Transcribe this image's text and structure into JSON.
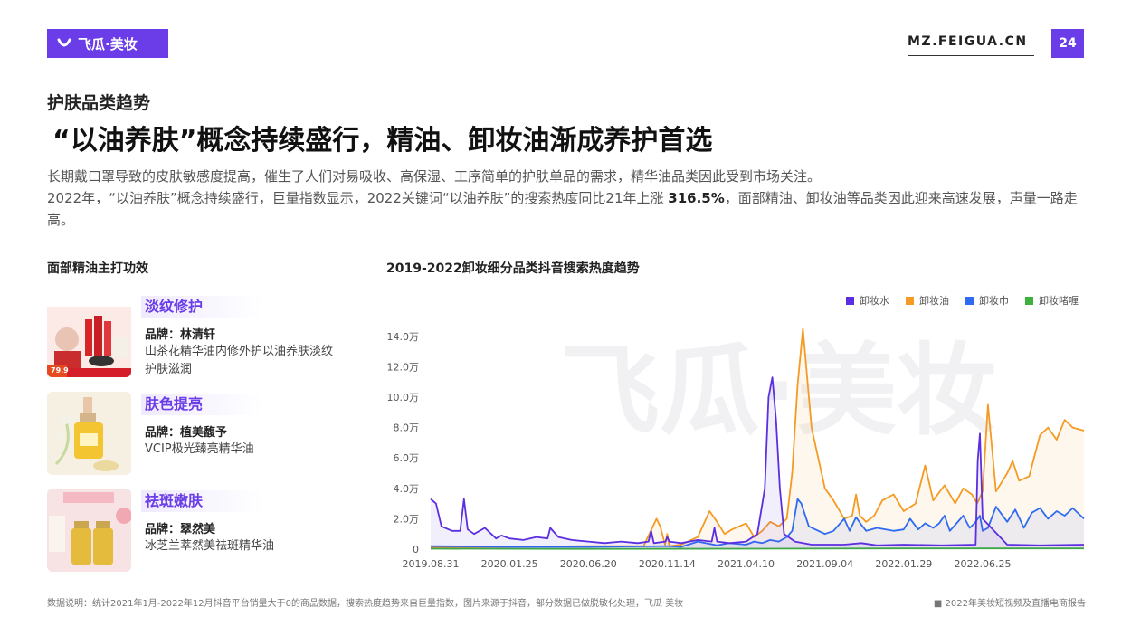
{
  "header": {
    "brand_label": "飞瓜·美妆",
    "site": "MZ.FEIGUA.CN",
    "page_number": "24",
    "accent_color": "#6a3de8"
  },
  "section_title": "护肤品类趋势",
  "headline": "“以油养肤”概念持续盛行，精油、卸妆油渐成养护首选",
  "intro": {
    "line1": "长期戴口罩导致的皮肤敏感度提高，催生了人们对易吸收、高保湿、工序简单的护肤单品的需求，精华油品类因此受到市场关注。",
    "line2_a": "2022年，“以油养肤”概念持续盛行，巨量指数显示，2022关键词“以油养肤”的搜索热度同比21年上涨 ",
    "line2_highlight": "316.5%",
    "line2_b": "，面部精油、卸妆油等品类因此迎来高速发展，声量一路走高。"
  },
  "left_panel": {
    "title": "面部精油主打功效",
    "cards": [
      {
        "effect": "淡纹修护",
        "brand": "品牌：林清轩",
        "product": "山茶花精华油内修外护以油养肤淡纹护肤滋润",
        "icon": "product-photo-red-bottles-icon",
        "thumb_text": "79.9"
      },
      {
        "effect": "肤色提亮",
        "brand": "品牌：植美馥予",
        "product": "VCIP极光臻亮精华油",
        "icon": "product-photo-dropper-bottle-icon"
      },
      {
        "effect": "祛斑嫩肤",
        "brand": "品牌：翠然美",
        "product": "冰芝兰萃然美祛斑精华油",
        "icon": "product-photo-gold-bottles-icon"
      }
    ]
  },
  "chart_data": {
    "type": "line",
    "title": "2019-2022卸妆细分品类抖音搜索热度趋势",
    "x_tick_labels": [
      "2019.08.31",
      "2020.01.25",
      "2020.06.20",
      "2020.11.14",
      "2021.04.10",
      "2021.09.04",
      "2022.01.29",
      "2022.06.25"
    ],
    "y_tick_labels": [
      "0",
      "2.0万",
      "4.0万",
      "6.0万",
      "8.0万",
      "10.0万",
      "12.0万",
      "14.0万"
    ],
    "ylim": [
      0,
      150000
    ],
    "x_range": [
      "2019.08.31",
      "2022.12.31"
    ],
    "grid": false,
    "legend_position": "top-right",
    "watermark": "飞瓜·美妆",
    "series": [
      {
        "name": "卸妆水",
        "color": "#5b2ee0",
        "x": [
          "2019.08.31",
          "2019.09.10",
          "2019.09.20",
          "2019.10.10",
          "2019.10.25",
          "2019.11.01",
          "2019.11.08",
          "2019.11.20",
          "2019.12.10",
          "2019.12.31",
          "2020.01.10",
          "2020.01.25",
          "2020.02.20",
          "2020.03.15",
          "2020.04.05",
          "2020.04.10",
          "2020.04.25",
          "2020.05.20",
          "2020.06.20",
          "2020.07.20",
          "2020.08.20",
          "2020.09.20",
          "2020.10.10",
          "2020.10.15",
          "2020.10.20",
          "2020.11.11",
          "2020.11.14",
          "2020.11.18",
          "2020.12.10",
          "2021.01.10",
          "2021.02.05",
          "2021.02.10",
          "2021.02.15",
          "2021.03.10",
          "2021.04.10",
          "2021.05.01",
          "2021.05.15",
          "2021.05.22",
          "2021.05.29",
          "2021.06.05",
          "2021.06.12",
          "2021.06.20",
          "2021.07.10",
          "2021.07.25",
          "2021.08.10",
          "2021.09.04",
          "2021.10.10",
          "2021.11.11",
          "2021.12.10",
          "2022.01.29",
          "2022.04.10",
          "2022.06.12",
          "2022.06.16",
          "2022.06.20",
          "2022.06.25",
          "2022.08.10",
          "2022.10.10",
          "2022.12.31"
        ],
        "values": [
          33000,
          30000,
          15000,
          12000,
          12000,
          33000,
          13000,
          10000,
          14000,
          7000,
          9000,
          7000,
          6000,
          8000,
          7000,
          14000,
          8000,
          6000,
          5000,
          4000,
          5000,
          4000,
          5000,
          12000,
          4000,
          5000,
          8000,
          5000,
          4000,
          6000,
          5000,
          14000,
          5000,
          4000,
          5000,
          10000,
          40000,
          100000,
          113000,
          85000,
          40000,
          10000,
          5000,
          4000,
          3000,
          3000,
          3000,
          4000,
          2500,
          3000,
          2500,
          3000,
          58000,
          76000,
          20000,
          3000,
          2500,
          3000
        ]
      },
      {
        "name": "卸妆油",
        "color": "#f59a23",
        "x": [
          "2019.08.31",
          "2020.06.20",
          "2020.10.01",
          "2020.10.25",
          "2020.11.01",
          "2020.11.10",
          "2020.11.14",
          "2020.11.18",
          "2020.12.10",
          "2021.01.10",
          "2021.02.01",
          "2021.02.15",
          "2021.03.01",
          "2021.03.15",
          "2021.04.10",
          "2021.04.25",
          "2021.05.10",
          "2021.05.25",
          "2021.06.10",
          "2021.06.25",
          "2021.07.05",
          "2021.07.15",
          "2021.07.25",
          "2021.08.10",
          "2021.09.04",
          "2021.09.20",
          "2021.10.10",
          "2021.10.25",
          "2021.11.01",
          "2021.11.08",
          "2021.11.20",
          "2021.12.05",
          "2021.12.20",
          "2022.01.10",
          "2022.01.29",
          "2022.02.20",
          "2022.03.10",
          "2022.03.25",
          "2022.04.15",
          "2022.05.05",
          "2022.05.20",
          "2022.06.05",
          "2022.06.15",
          "2022.06.25",
          "2022.07.05",
          "2022.07.20",
          "2022.08.10",
          "2022.08.20",
          "2022.09.01",
          "2022.09.20",
          "2022.10.10",
          "2022.10.25",
          "2022.11.10",
          "2022.11.25",
          "2022.12.10",
          "2022.12.31"
        ],
        "values": [
          1000,
          2000,
          2000,
          20000,
          15000,
          3000,
          10000,
          2000,
          3000,
          8000,
          25000,
          18000,
          10000,
          13000,
          17000,
          8000,
          12000,
          18000,
          15000,
          20000,
          50000,
          108000,
          145000,
          80000,
          40000,
          32000,
          20000,
          22000,
          36000,
          22000,
          18000,
          22000,
          32000,
          36000,
          25000,
          30000,
          55000,
          32000,
          42000,
          30000,
          40000,
          36000,
          30000,
          38000,
          95000,
          38000,
          50000,
          58000,
          45000,
          48000,
          75000,
          80000,
          72000,
          85000,
          80000,
          78000
        ]
      },
      {
        "name": "卸妆巾",
        "color": "#2f6bf0",
        "x": [
          "2019.08.31",
          "2020.01.25",
          "2020.06.20",
          "2020.11.14",
          "2020.12.10",
          "2021.01.10",
          "2021.02.15",
          "2021.03.10",
          "2021.04.10",
          "2021.04.25",
          "2021.05.10",
          "2021.05.25",
          "2021.06.10",
          "2021.06.25",
          "2021.07.05",
          "2021.07.15",
          "2021.07.22",
          "2021.08.05",
          "2021.09.04",
          "2021.09.20",
          "2021.10.10",
          "2021.10.20",
          "2021.11.01",
          "2021.11.11",
          "2021.11.20",
          "2021.12.10",
          "2022.01.10",
          "2022.01.29",
          "2022.02.10",
          "2022.02.25",
          "2022.03.10",
          "2022.03.25",
          "2022.04.05",
          "2022.04.15",
          "2022.04.25",
          "2022.05.05",
          "2022.05.20",
          "2022.06.01",
          "2022.06.10",
          "2022.06.20",
          "2022.06.25",
          "2022.07.05",
          "2022.07.20",
          "2022.08.10",
          "2022.08.25",
          "2022.09.10",
          "2022.09.25",
          "2022.10.10",
          "2022.10.25",
          "2022.11.10",
          "2022.11.25",
          "2022.12.10",
          "2022.12.31"
        ],
        "values": [
          2000,
          1500,
          1500,
          2000,
          1500,
          5000,
          2500,
          4000,
          3000,
          5000,
          4000,
          6000,
          5000,
          8000,
          12000,
          33000,
          30000,
          15000,
          10000,
          12000,
          20000,
          12000,
          21000,
          16000,
          12000,
          14000,
          12000,
          13000,
          20000,
          13000,
          17000,
          14000,
          17000,
          22000,
          12000,
          16000,
          22000,
          14000,
          17000,
          22000,
          12000,
          14000,
          28000,
          18000,
          26000,
          14000,
          24000,
          27000,
          20000,
          25000,
          22000,
          27000,
          20000
        ]
      },
      {
        "name": "卸妆啫喱",
        "color": "#3db03d",
        "x": [
          "2019.08.31",
          "2020.06.20",
          "2021.04.10",
          "2022.01.29",
          "2022.12.31"
        ],
        "values": [
          300,
          200,
          300,
          500,
          500
        ]
      }
    ]
  },
  "footer": {
    "note": "数据说明：统计2021年1月-2022年12月抖音平台销量大于0的商品数据，搜索热度趋势来自巨量指数，图片来源于抖音，部分数据已做脱敏化处理，飞瓜·美妆",
    "report": "■ 2022年美妆短视频及直播电商报告"
  }
}
